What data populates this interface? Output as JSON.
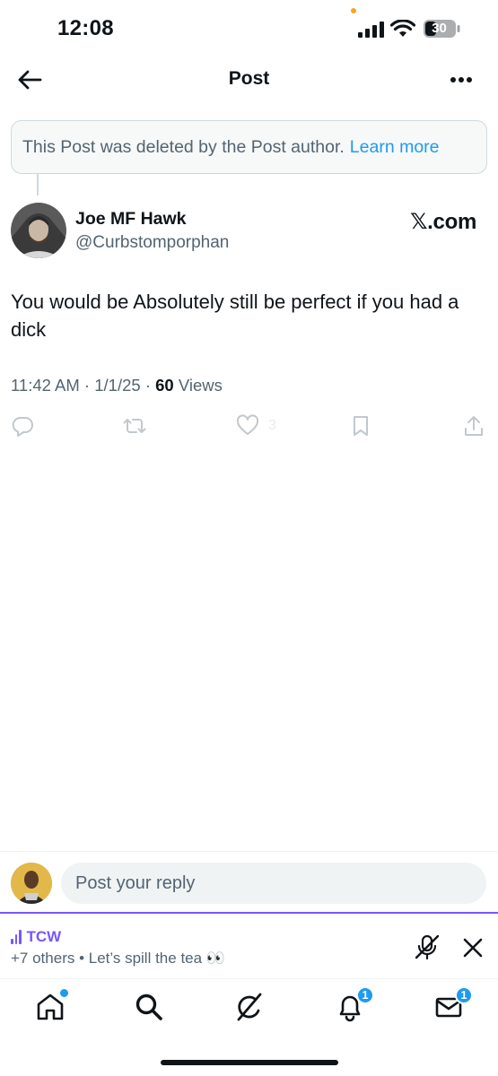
{
  "status_bar": {
    "time": "12:08",
    "battery": "30"
  },
  "header": {
    "title": "Post"
  },
  "deleted_notice": {
    "text": "This Post was deleted by the Post author.",
    "link": "Learn more"
  },
  "post": {
    "author_name": "Joe MF Hawk",
    "author_handle": "@Curbstomporphan",
    "source_label": "𝕏.com",
    "text": "You would be Absolutely still be perfect if you had a dick",
    "time": "11:42 AM",
    "date": "1/1/25",
    "views_count": "60",
    "views_label": "Views",
    "like_count": "3"
  },
  "reply": {
    "placeholder": "Post your reply"
  },
  "space": {
    "name": "TCW",
    "subtitle": "+7 others • Let’s spill the tea 👀"
  },
  "bottom_nav": {
    "notifications_badge": "1",
    "messages_badge": "1"
  },
  "colors": {
    "accent": "#1d9bf0",
    "space_purple": "#7856ff",
    "secondary_text": "#536471"
  }
}
